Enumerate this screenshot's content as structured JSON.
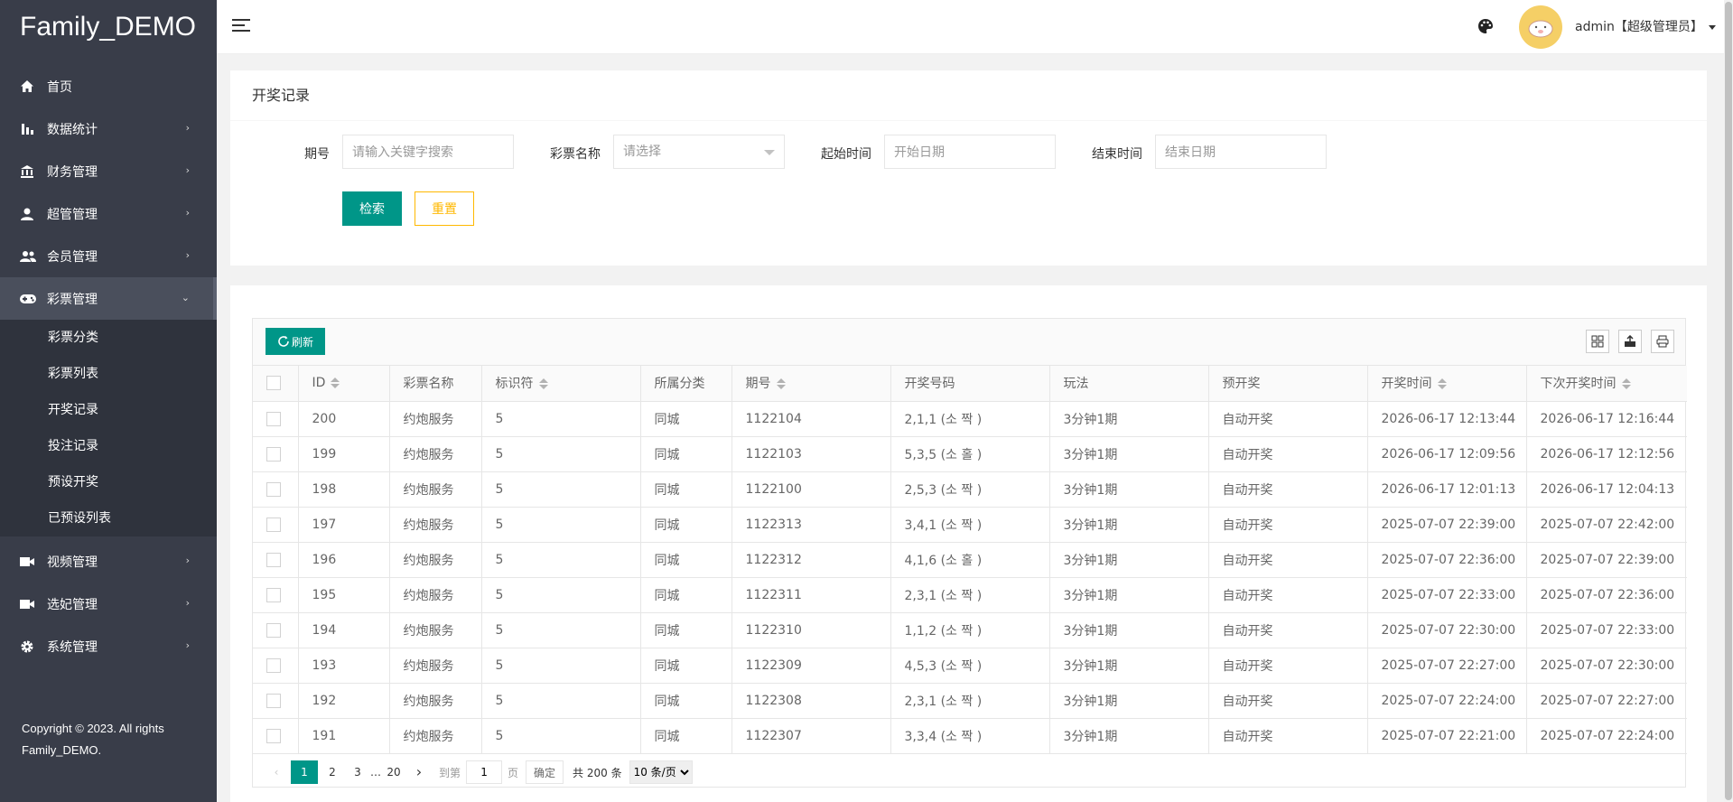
{
  "app": {
    "title": "Family_DEMO"
  },
  "sidebar": {
    "items": [
      {
        "label": "首页",
        "icon": "home-icon"
      },
      {
        "label": "数据统计",
        "icon": "bar-chart-icon"
      },
      {
        "label": "财务管理",
        "icon": "bank-icon"
      },
      {
        "label": "超管管理",
        "icon": "user-icon"
      },
      {
        "label": "会员管理",
        "icon": "users-icon"
      },
      {
        "label": "彩票管理",
        "icon": "gamepad-icon"
      }
    ],
    "subitems": [
      "彩票分类",
      "彩票列表",
      "开奖记录",
      "投注记录",
      "预设开奖",
      "已预设列表"
    ],
    "items_after": [
      {
        "label": "视频管理",
        "icon": "video-icon"
      },
      {
        "label": "选妃管理",
        "icon": "video-icon"
      },
      {
        "label": "系统管理",
        "icon": "gear-icon"
      }
    ],
    "copyright_line1": "Copyright © 2023. All rights",
    "copyright_line2": "Family_DEMO."
  },
  "header": {
    "user": "admin【超级管理员】"
  },
  "filter": {
    "title": "开奖记录",
    "labels": {
      "issue": "期号",
      "lottery": "彩票名称",
      "start": "起始时间",
      "end": "结束时间"
    },
    "placeholders": {
      "issue": "请输入关键字搜索",
      "lottery": "请选择",
      "start": "开始日期",
      "end": "结束日期"
    },
    "search_label": "检索",
    "reset_label": "重置"
  },
  "table": {
    "refresh_label": "刷新",
    "columns": [
      "ID",
      "彩票名称",
      "标识符",
      "所属分类",
      "期号",
      "开奖号码",
      "玩法",
      "预开奖",
      "开奖时间",
      "下次开奖时间"
    ],
    "rows": [
      [
        "200",
        "约炮服务",
        "5",
        "同城",
        "1122104",
        "2,1,1 (소 짝 )",
        "3分钟1期",
        "自动开奖",
        "2026-06-17 12:13:44",
        "2026-06-17 12:16:44"
      ],
      [
        "199",
        "约炮服务",
        "5",
        "同城",
        "1122103",
        "5,3,5 (소 홀 )",
        "3分钟1期",
        "自动开奖",
        "2026-06-17 12:09:56",
        "2026-06-17 12:12:56"
      ],
      [
        "198",
        "约炮服务",
        "5",
        "同城",
        "1122100",
        "2,5,3 (소 짝 )",
        "3分钟1期",
        "自动开奖",
        "2026-06-17 12:01:13",
        "2026-06-17 12:04:13"
      ],
      [
        "197",
        "约炮服务",
        "5",
        "同城",
        "1122313",
        "3,4,1 (소 짝 )",
        "3分钟1期",
        "自动开奖",
        "2025-07-07 22:39:00",
        "2025-07-07 22:42:00"
      ],
      [
        "196",
        "约炮服务",
        "5",
        "同城",
        "1122312",
        "4,1,6 (소 홀 )",
        "3分钟1期",
        "自动开奖",
        "2025-07-07 22:36:00",
        "2025-07-07 22:39:00"
      ],
      [
        "195",
        "约炮服务",
        "5",
        "同城",
        "1122311",
        "2,3,1 (소 짝 )",
        "3分钟1期",
        "自动开奖",
        "2025-07-07 22:33:00",
        "2025-07-07 22:36:00"
      ],
      [
        "194",
        "约炮服务",
        "5",
        "同城",
        "1122310",
        "1,1,2 (소 짝 )",
        "3分钟1期",
        "自动开奖",
        "2025-07-07 22:30:00",
        "2025-07-07 22:33:00"
      ],
      [
        "193",
        "约炮服务",
        "5",
        "同城",
        "1122309",
        "4,5,3 (소 짝 )",
        "3分钟1期",
        "自动开奖",
        "2025-07-07 22:27:00",
        "2025-07-07 22:30:00"
      ],
      [
        "192",
        "约炮服务",
        "5",
        "同城",
        "1122308",
        "2,3,1 (소 짝 )",
        "3分钟1期",
        "自动开奖",
        "2025-07-07 22:24:00",
        "2025-07-07 22:27:00"
      ],
      [
        "191",
        "约炮服务",
        "5",
        "同城",
        "1122307",
        "3,3,4 (소 짝 )",
        "3分钟1期",
        "自动开奖",
        "2025-07-07 22:21:00",
        "2025-07-07 22:24:00"
      ]
    ]
  },
  "pager": {
    "pages": [
      "1",
      "2",
      "3"
    ],
    "ellipsis": "…",
    "last": "20",
    "goto_label": "到第",
    "page_value": "1",
    "page_suffix": "页",
    "confirm_label": "确定",
    "total_label": "共 200 条",
    "size_label": "10 条/页"
  },
  "colors": {
    "accent": "#009688",
    "sidebar": "#393d49",
    "warning": "#ffb800"
  }
}
